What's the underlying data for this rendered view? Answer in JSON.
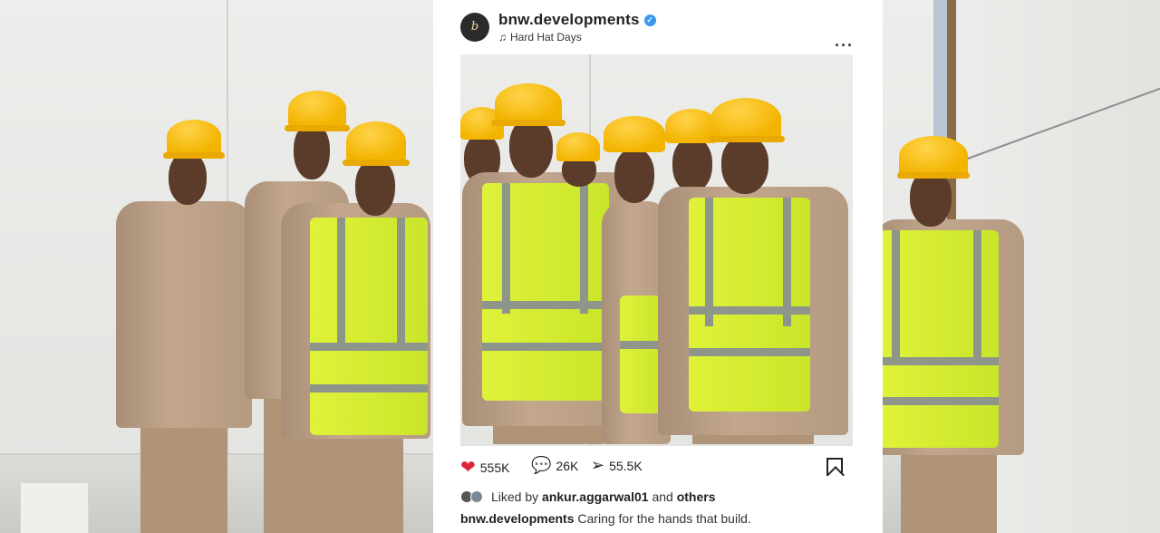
{
  "post": {
    "username": "bnw.developments",
    "audio": "Hard Hat Days",
    "avatar_text": "b"
  },
  "engagement": {
    "likes": "555K",
    "comments": "26K",
    "shares": "55.5K"
  },
  "liked_by": {
    "prefix": "Liked by",
    "user": "ankur.aggarwal01",
    "joiner": "and",
    "suffix": "others"
  },
  "caption": {
    "author": "bnw.developments",
    "text": "Caring for the hands that build."
  },
  "colors": {
    "like": "#e0243b",
    "verified": "#3897f0",
    "helmet": "#f3b400",
    "vest": "#d4ec30",
    "uniform": "#b99d85"
  },
  "icons": [
    "heart-icon",
    "comment-icon",
    "share-icon",
    "bookmark-icon",
    "more-icon",
    "music-note-icon",
    "verified-icon"
  ]
}
